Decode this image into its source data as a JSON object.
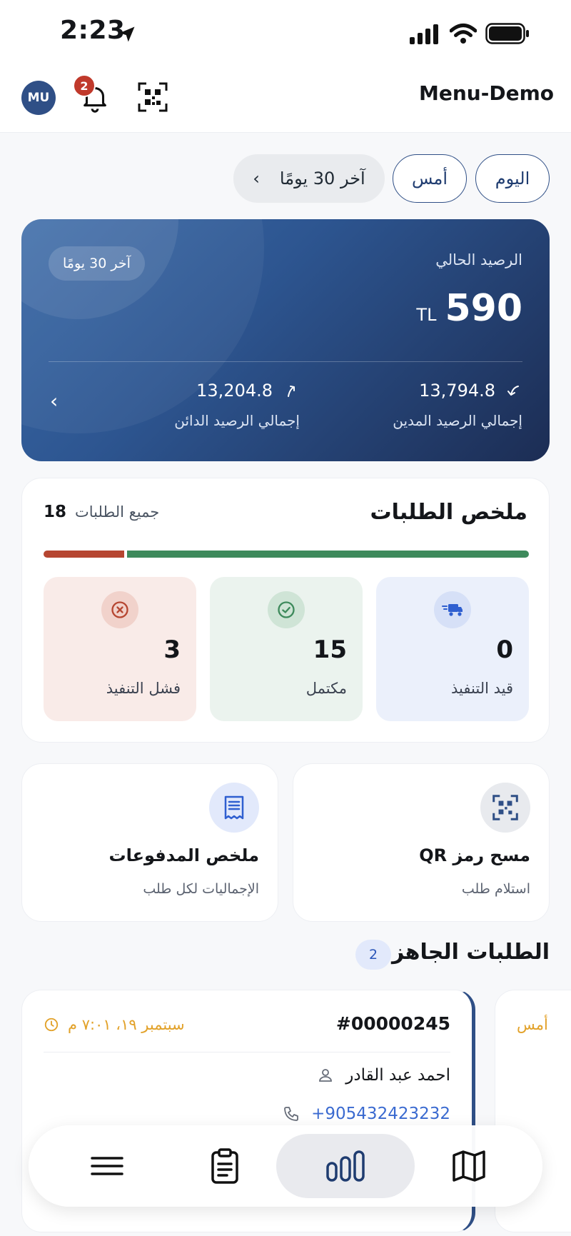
{
  "status_bar": {
    "time": "2:23"
  },
  "header": {
    "avatar_initials": "MU",
    "notification_count": "2",
    "app_title": "Menu-Demo"
  },
  "period_filters": {
    "today": "اليوم",
    "yesterday": "أمس",
    "range": "آخر 30 يومًا"
  },
  "balance": {
    "period_badge": "آخر 30 يومًا",
    "label": "الرصيد الحالي",
    "amount": "590",
    "currency": "TL",
    "debit_value": "13,794.8",
    "debit_label": "إجمالي الرصيد المدين",
    "credit_value": "13,204.8",
    "credit_label": "إجمالي الرصيد الدائن"
  },
  "orders_summary": {
    "title": "ملخص الطلبات",
    "all_label": "جميع الطلبات",
    "all_count": "18",
    "progress": {
      "failed_fraction": 0.167,
      "completed_fraction": 0.833
    },
    "stats": {
      "failed": {
        "value": "3",
        "label": "فشل التنفيذ",
        "icon": "x-circle-icon"
      },
      "completed": {
        "value": "15",
        "label": "مكتمل",
        "icon": "check-circle-icon"
      },
      "in_progress": {
        "value": "0",
        "label": "قيد التنفيذ",
        "icon": "delivery-truck-icon"
      }
    },
    "colors": {
      "failed": "#b64631",
      "completed": "#3e8a5c",
      "in_progress": "#2f5fd0"
    }
  },
  "actions": {
    "payments": {
      "title": "ملخص المدفوعات",
      "subtitle": "الإجماليات لكل طلب"
    },
    "qr_scan": {
      "title": "مسح رمز QR",
      "subtitle": "استلام طلب"
    }
  },
  "ready_orders": {
    "title": "الطلبات الجاهزة",
    "count": "2",
    "items": [
      {
        "id": "#00000245",
        "date": "سبتمبر ١٩، ٧:٠١ م",
        "customer": "احمد عبد القادر",
        "phone": "+905432423232"
      },
      {
        "date": "أمس"
      }
    ]
  },
  "colors": {
    "brand": "#2f4f86",
    "accent_date": "#e2a128"
  }
}
